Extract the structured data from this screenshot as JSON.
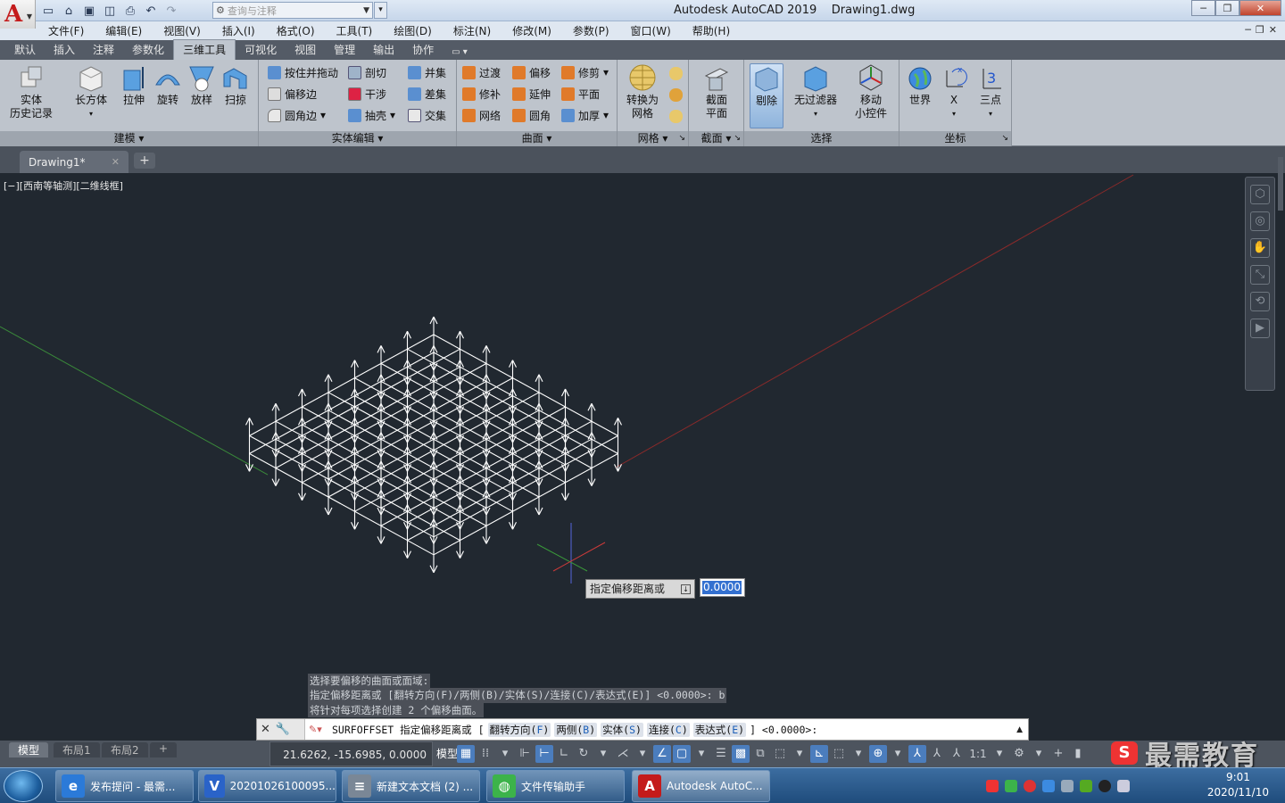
{
  "title_bar": {
    "app_title": "Autodesk AutoCAD 2019",
    "file_name": "Drawing1.dwg",
    "search_placeholder": "查询与注释"
  },
  "menu": [
    "文件(F)",
    "编辑(E)",
    "视图(V)",
    "插入(I)",
    "格式(O)",
    "工具(T)",
    "绘图(D)",
    "标注(N)",
    "修改(M)",
    "参数(P)",
    "窗口(W)",
    "帮助(H)"
  ],
  "ribbon_tabs": [
    "默认",
    "插入",
    "注释",
    "参数化",
    "三维工具",
    "可视化",
    "视图",
    "管理",
    "输出",
    "协作"
  ],
  "active_tab": "三维工具",
  "panels": {
    "model": {
      "title": "建模",
      "history_l1": "实体",
      "history_l2": "历史记录",
      "box": "长方体",
      "extrude": "拉伸",
      "revolve": "旋转",
      "loft": "放样",
      "sweep": "扫掠"
    },
    "solid_edit": {
      "title": "实体编辑",
      "presspull": "按住并拖动",
      "offset_edge": "偏移边",
      "fillet_edge": "圆角边",
      "slice": "剖切",
      "interfere": "干涉",
      "shell": "抽壳",
      "union": "并集",
      "subtract": "差集",
      "intersect": "交集"
    },
    "surface": {
      "title": "曲面",
      "blend": "过渡",
      "patch": "修补",
      "network": "网络",
      "offset": "偏移",
      "extend": "延伸",
      "fillet": "圆角",
      "trim": "修剪",
      "planar": "平面",
      "thicken": "加厚"
    },
    "mesh": {
      "title": "网格",
      "convert_l1": "转换为",
      "convert_l2": "网格"
    },
    "section": {
      "title": "截面",
      "plane_l1": "截面",
      "plane_l2": "平面"
    },
    "selection": {
      "title": "选择",
      "cull": "剔除",
      "no_filter": "无过滤器",
      "gizmo_l1": "移动",
      "gizmo_l2": "小控件"
    },
    "ucs": {
      "title": "坐标",
      "world": "世界",
      "x": "X",
      "three_point": "三点"
    }
  },
  "file_tab": "Drawing1*",
  "viewport_label": "[−][西南等轴测][二维线框]",
  "tooltip_text": "指定偏移距离或",
  "dynamic_input": "0.0000",
  "command_history": [
    "选择要偏移的曲面或面域:",
    "指定偏移距离或 [翻转方向(F)/两侧(B)/实体(S)/连接(C)/表达式(E)] <0.0000>: b",
    "将针对每项选择创建 2 个偏移曲面。"
  ],
  "command": {
    "prompt": "SURFOFFSET 指定偏移距离或 [",
    "options": [
      {
        "pre": "翻转方向(",
        "key": "F",
        "post": ")"
      },
      {
        "pre": "两侧(",
        "key": "B",
        "post": ")"
      },
      {
        "pre": "实体(",
        "key": "S",
        "post": ")"
      },
      {
        "pre": "连接(",
        "key": "C",
        "post": ")"
      },
      {
        "pre": "表达式(",
        "key": "E",
        "post": ")"
      }
    ],
    "suffix": "] <0.0000>:"
  },
  "layout_tabs": [
    "模型",
    "布局1",
    "布局2"
  ],
  "coords": "21.6262, -15.6985, 0.0000",
  "status": {
    "model": "模型",
    "scale": "1:1"
  },
  "watermark": "最需教育",
  "taskbar": [
    {
      "label": "发布提问 - 最需...",
      "color": "#2b7ad8",
      "glyph": "e"
    },
    {
      "label": "20201026100095...",
      "color": "#2a63c8",
      "glyph": "V"
    },
    {
      "label": "新建文本文档 (2) ...",
      "color": "#7a8796",
      "glyph": "≡"
    },
    {
      "label": "文件传输助手",
      "color": "#3cb34a",
      "glyph": "◍"
    },
    {
      "label": "Autodesk AutoC...",
      "color": "#c41b1b",
      "glyph": "A"
    }
  ],
  "clock": {
    "time": "9:01",
    "date": "2020/11/10"
  }
}
